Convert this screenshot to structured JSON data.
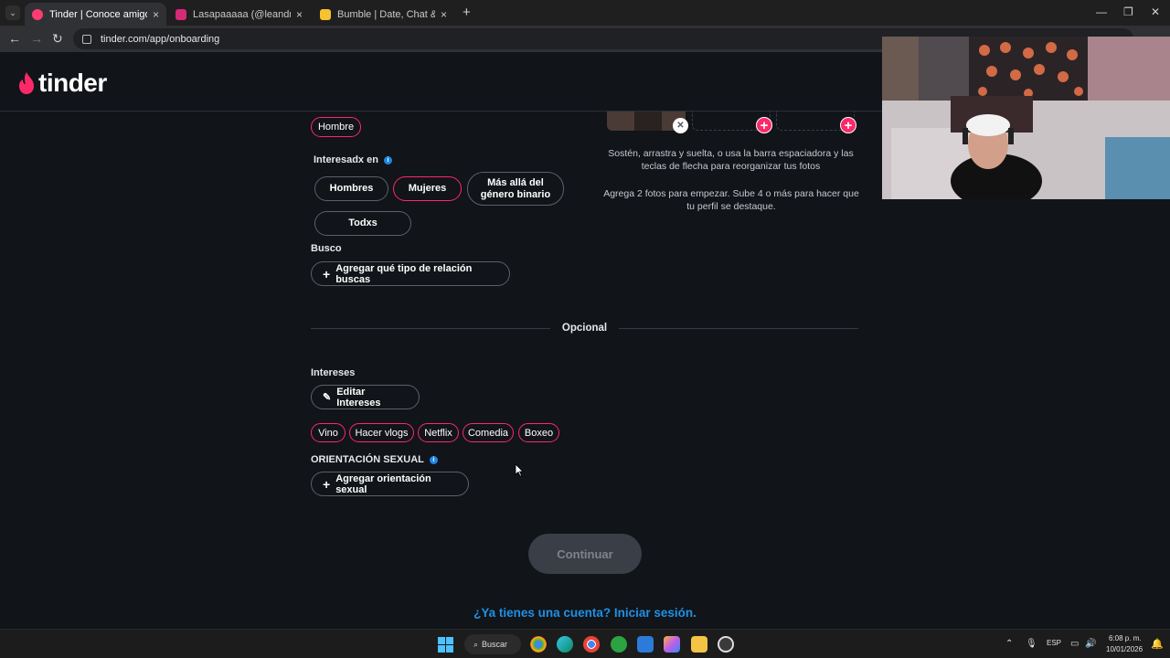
{
  "browser": {
    "tabs": [
      {
        "label": "Tinder | Conoce amigos y gente",
        "favicon_color": "#fe3c72",
        "active": true
      },
      {
        "label": "Lasapaaaaa (@leandroloaizam)",
        "favicon_color": "#d62976",
        "active": false
      },
      {
        "label": "Bumble | Date, Chat & Meet Ne",
        "favicon_color": "#f7c22e",
        "active": false
      }
    ],
    "tab_close": "×",
    "new_tab": "+",
    "url": "tinder.com/app/onboarding"
  },
  "brand": {
    "name": "tinder",
    "color": "#fd2869"
  },
  "form": {
    "gender_selected": "Hombre",
    "interested_label": "Interesadx en",
    "interested_options": [
      "Hombres",
      "Mujeres",
      "Más allá del género binario",
      "Todxs"
    ],
    "interested_selected": "Mujeres",
    "looking_label": "Busco",
    "looking_button": "Agregar qué tipo de relación buscas",
    "optional_divider": "Opcional",
    "interests_label": "Intereses",
    "interests_button": "Editar Intereses",
    "interests_tags": [
      "Vino",
      "Hacer vlogs",
      "Netflix",
      "Comedia",
      "Boxeo"
    ],
    "orientation_label": "ORIENTACIÓN SEXUAL",
    "orientation_button": "Agregar orientación sexual",
    "continue_button": "Continuar",
    "login_link": "¿Ya tienes una cuenta? Iniciar sesión."
  },
  "photos": {
    "help_text": "Sostén, arrastra y suelta, o usa la barra espaciadora y las teclas de flecha para reorganizar tus fotos",
    "hint_text": "Agrega 2 fotos para empezar. Sube 4 o más para hacer que tu perfil se destaque."
  },
  "taskbar": {
    "search_label": "Buscar",
    "language": "ESP",
    "time": "6:08 p. m.",
    "date": "10/01/2026"
  },
  "colors": {
    "accent": "#fd2869",
    "link": "#1f90e6",
    "info": "#1e88e5"
  }
}
